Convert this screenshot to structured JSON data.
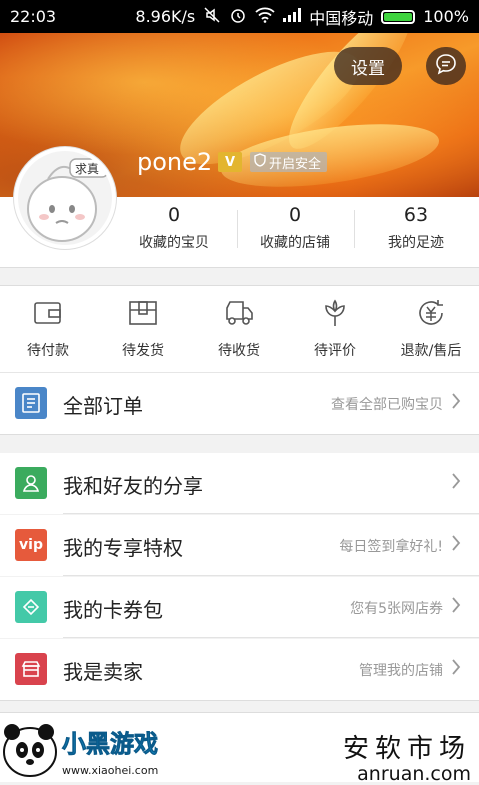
{
  "status_bar": {
    "time": "22:03",
    "net_speed": "8.96K/s",
    "carrier": "中国移动",
    "battery": "100%"
  },
  "header": {
    "settings_label": "设置",
    "username": "pone2",
    "vip_mark": "V",
    "security_label": "开启安全",
    "avatar_caption": "求真"
  },
  "stats": [
    {
      "value": "0",
      "label": "收藏的宝贝"
    },
    {
      "value": "0",
      "label": "收藏的店铺"
    },
    {
      "value": "63",
      "label": "我的足迹"
    }
  ],
  "order_status": [
    {
      "label": "待付款",
      "icon": "wallet-icon"
    },
    {
      "label": "待发货",
      "icon": "package-icon"
    },
    {
      "label": "待收货",
      "icon": "truck-icon"
    },
    {
      "label": "待评价",
      "icon": "flower-icon"
    },
    {
      "label": "退款/售后",
      "icon": "refund-icon"
    }
  ],
  "rows": [
    {
      "title": "全部订单",
      "hint": "查看全部已购宝贝",
      "icon": "order-list-icon",
      "color": "#4a86c8"
    },
    {
      "title": "我和好友的分享",
      "hint": "",
      "icon": "share-icon",
      "color": "#3bab5e"
    },
    {
      "title": "我的专享特权",
      "hint": "每日签到拿好礼!",
      "icon": "vip-icon",
      "color": "#e65a3c",
      "badge": "vip"
    },
    {
      "title": "我的卡券包",
      "hint": "您有5张网店券",
      "icon": "coupon-icon",
      "color": "#44c9a8"
    },
    {
      "title": "我是卖家",
      "hint": "管理我的店铺",
      "icon": "shop-icon",
      "color": "#d9434d"
    }
  ],
  "watermark": {
    "right_cn": "安软市场",
    "right_en": "anruan.com",
    "left_brand": "小黑游戏",
    "left_url": "www.xiaohei.com"
  },
  "colors": {
    "accent_orange": "#ef7a1a",
    "battery_green": "#3fd33f"
  }
}
